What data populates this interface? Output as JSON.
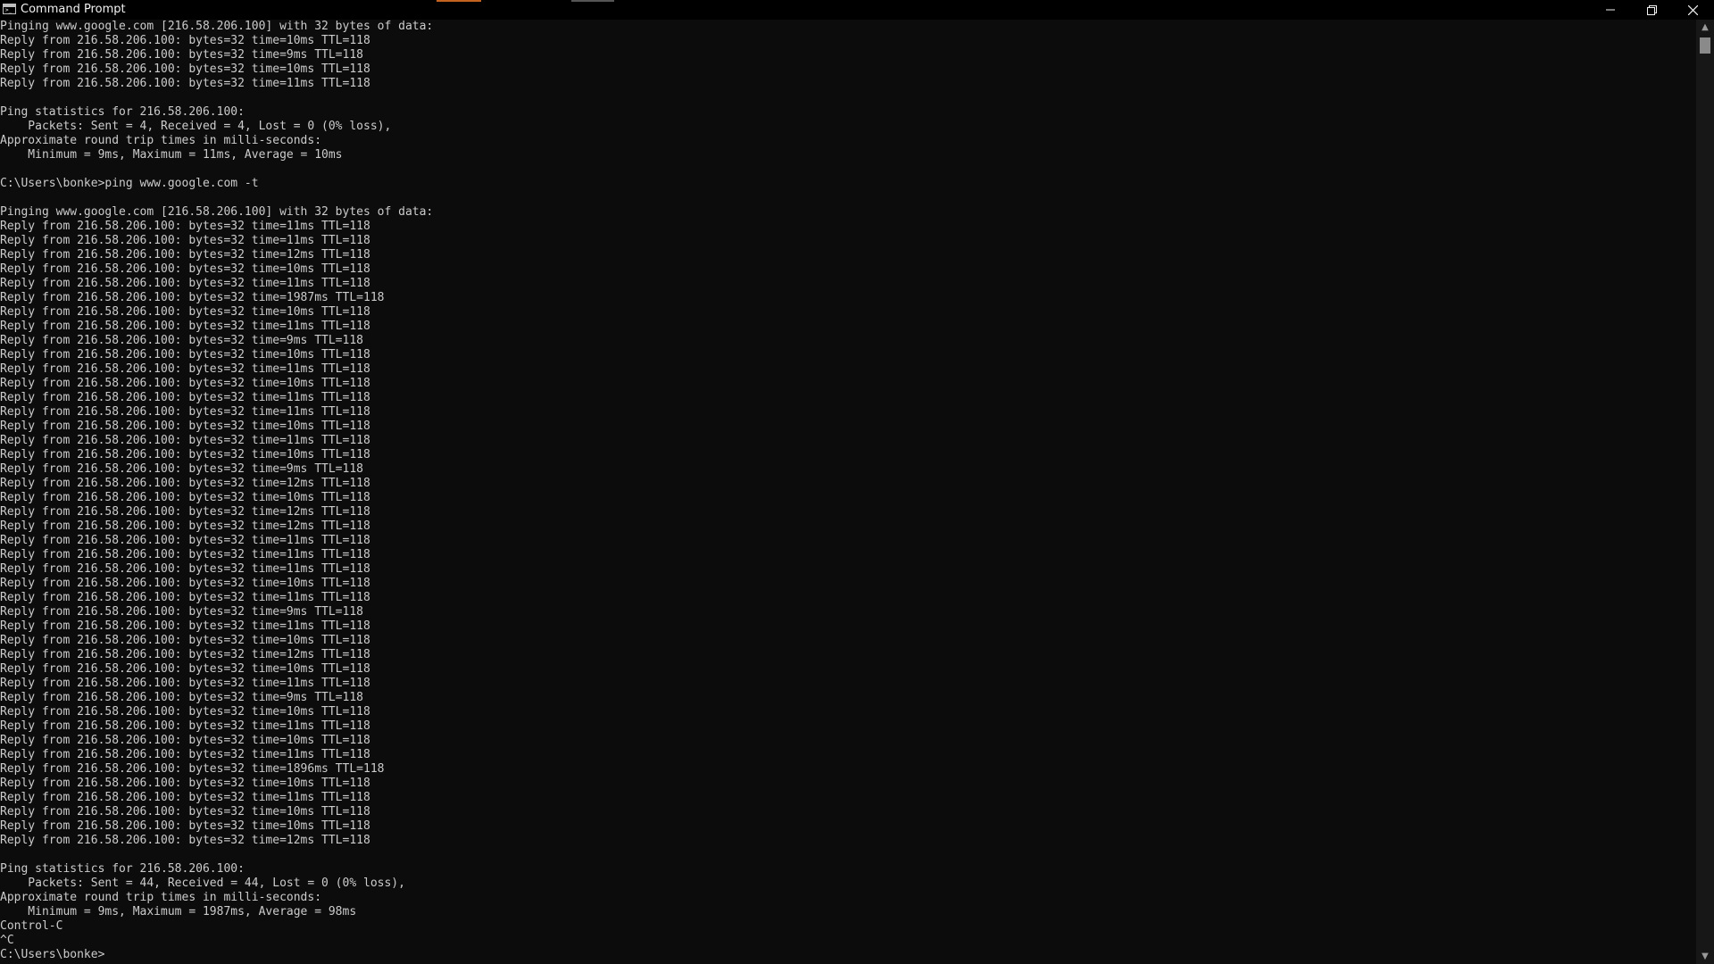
{
  "window": {
    "title": "Command Prompt",
    "icon": "console-icon",
    "controls": [
      "minimize-icon",
      "restore-icon",
      "close-icon"
    ]
  },
  "console": {
    "lines": [
      "Pinging www.google.com [216.58.206.100] with 32 bytes of data:",
      "Reply from 216.58.206.100: bytes=32 time=10ms TTL=118",
      "Reply from 216.58.206.100: bytes=32 time=9ms TTL=118",
      "Reply from 216.58.206.100: bytes=32 time=10ms TTL=118",
      "Reply from 216.58.206.100: bytes=32 time=11ms TTL=118",
      "",
      "Ping statistics for 216.58.206.100:",
      "    Packets: Sent = 4, Received = 4, Lost = 0 (0% loss),",
      "Approximate round trip times in milli-seconds:",
      "    Minimum = 9ms, Maximum = 11ms, Average = 10ms",
      "",
      "C:\\Users\\bonke>ping www.google.com -t",
      "",
      "Pinging www.google.com [216.58.206.100] with 32 bytes of data:",
      "Reply from 216.58.206.100: bytes=32 time=11ms TTL=118",
      "Reply from 216.58.206.100: bytes=32 time=11ms TTL=118",
      "Reply from 216.58.206.100: bytes=32 time=12ms TTL=118",
      "Reply from 216.58.206.100: bytes=32 time=10ms TTL=118",
      "Reply from 216.58.206.100: bytes=32 time=11ms TTL=118",
      "Reply from 216.58.206.100: bytes=32 time=1987ms TTL=118",
      "Reply from 216.58.206.100: bytes=32 time=10ms TTL=118",
      "Reply from 216.58.206.100: bytes=32 time=11ms TTL=118",
      "Reply from 216.58.206.100: bytes=32 time=9ms TTL=118",
      "Reply from 216.58.206.100: bytes=32 time=10ms TTL=118",
      "Reply from 216.58.206.100: bytes=32 time=11ms TTL=118",
      "Reply from 216.58.206.100: bytes=32 time=10ms TTL=118",
      "Reply from 216.58.206.100: bytes=32 time=11ms TTL=118",
      "Reply from 216.58.206.100: bytes=32 time=11ms TTL=118",
      "Reply from 216.58.206.100: bytes=32 time=10ms TTL=118",
      "Reply from 216.58.206.100: bytes=32 time=11ms TTL=118",
      "Reply from 216.58.206.100: bytes=32 time=10ms TTL=118",
      "Reply from 216.58.206.100: bytes=32 time=9ms TTL=118",
      "Reply from 216.58.206.100: bytes=32 time=12ms TTL=118",
      "Reply from 216.58.206.100: bytes=32 time=10ms TTL=118",
      "Reply from 216.58.206.100: bytes=32 time=12ms TTL=118",
      "Reply from 216.58.206.100: bytes=32 time=12ms TTL=118",
      "Reply from 216.58.206.100: bytes=32 time=11ms TTL=118",
      "Reply from 216.58.206.100: bytes=32 time=11ms TTL=118",
      "Reply from 216.58.206.100: bytes=32 time=11ms TTL=118",
      "Reply from 216.58.206.100: bytes=32 time=10ms TTL=118",
      "Reply from 216.58.206.100: bytes=32 time=11ms TTL=118",
      "Reply from 216.58.206.100: bytes=32 time=9ms TTL=118",
      "Reply from 216.58.206.100: bytes=32 time=11ms TTL=118",
      "Reply from 216.58.206.100: bytes=32 time=10ms TTL=118",
      "Reply from 216.58.206.100: bytes=32 time=12ms TTL=118",
      "Reply from 216.58.206.100: bytes=32 time=10ms TTL=118",
      "Reply from 216.58.206.100: bytes=32 time=11ms TTL=118",
      "Reply from 216.58.206.100: bytes=32 time=9ms TTL=118",
      "Reply from 216.58.206.100: bytes=32 time=10ms TTL=118",
      "Reply from 216.58.206.100: bytes=32 time=11ms TTL=118",
      "Reply from 216.58.206.100: bytes=32 time=10ms TTL=118",
      "Reply from 216.58.206.100: bytes=32 time=11ms TTL=118",
      "Reply from 216.58.206.100: bytes=32 time=1896ms TTL=118",
      "Reply from 216.58.206.100: bytes=32 time=10ms TTL=118",
      "Reply from 216.58.206.100: bytes=32 time=11ms TTL=118",
      "Reply from 216.58.206.100: bytes=32 time=10ms TTL=118",
      "Reply from 216.58.206.100: bytes=32 time=10ms TTL=118",
      "Reply from 216.58.206.100: bytes=32 time=12ms TTL=118",
      "",
      "Ping statistics for 216.58.206.100:",
      "    Packets: Sent = 44, Received = 44, Lost = 0 (0% loss),",
      "Approximate round trip times in milli-seconds:",
      "    Minimum = 9ms, Maximum = 1987ms, Average = 98ms",
      "Control-C",
      "^C",
      "C:\\Users\\bonke>"
    ]
  },
  "scrollbar": {
    "up_icon": "chevron-up-icon",
    "down_icon": "chevron-down-icon",
    "up_glyph": "▲",
    "down_glyph": "▼"
  },
  "colors": {
    "background": "#0c0c0c",
    "text": "#cccccc",
    "titlebar": "#000000"
  }
}
